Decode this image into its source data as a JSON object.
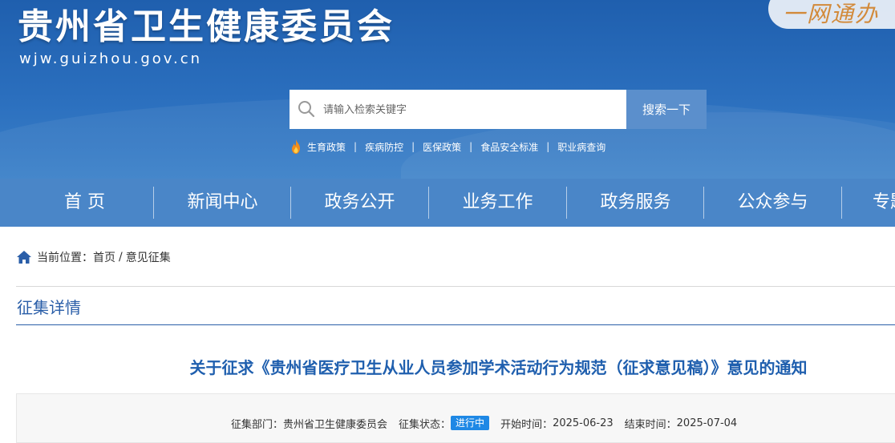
{
  "header": {
    "site_title": "贵州省卫生健康委员会",
    "site_domain": "wjw.guizhou.gov.cn",
    "oneweb_label": "一网通办"
  },
  "search": {
    "placeholder": "请输入检索关键字",
    "button_label": "搜索一下"
  },
  "hot_links": [
    "生育政策",
    "疾病防控",
    "医保政策",
    "食品安全标准",
    "职业病查询"
  ],
  "nav": [
    "首  页",
    "新闻中心",
    "政务公开",
    "业务工作",
    "政务服务",
    "公众参与",
    "专题专栏"
  ],
  "breadcrumb": {
    "prefix": "当前位置：",
    "home": "首页",
    "separator": "/",
    "current": "意见征集"
  },
  "section_title": "征集详情",
  "document": {
    "title": "关于征求《贵州省医疗卫生从业人员参加学术活动行为规范（征求意见稿）》意见的通知",
    "department_label": "征集部门：",
    "department": "贵州省卫生健康委员会",
    "status_label": "征集状态：",
    "status": "进行中",
    "start_label": "开始时间：",
    "start_date": "2025-06-23",
    "end_label": "结束时间：",
    "end_date": "2025-07-04"
  },
  "colors": {
    "banner": "#2b6fbe",
    "nav": "#4a86c8",
    "accent": "#1f5fae",
    "badge": "#1e88e5"
  }
}
